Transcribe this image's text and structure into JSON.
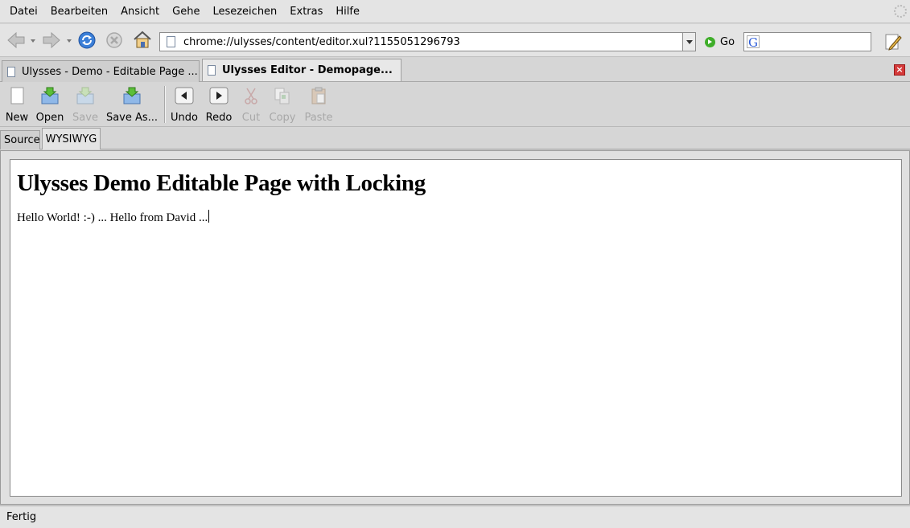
{
  "menubar": {
    "items": [
      {
        "label": "Datei"
      },
      {
        "label": "Bearbeiten"
      },
      {
        "label": "Ansicht"
      },
      {
        "label": "Gehe"
      },
      {
        "label": "Lesezeichen"
      },
      {
        "label": "Extras"
      },
      {
        "label": "Hilfe"
      }
    ]
  },
  "navbar": {
    "url": "chrome://ulysses/content/editor.xul?1155051296793",
    "go_label": "Go",
    "search_value": ""
  },
  "tabs": [
    {
      "label": "Ulysses - Demo - Editable Page ...",
      "active": false
    },
    {
      "label": "Ulysses Editor - Demopage...",
      "active": true
    }
  ],
  "editor_toolbar": {
    "new": "New",
    "open": "Open",
    "save": "Save",
    "save_as": "Save As...",
    "undo": "Undo",
    "redo": "Redo",
    "cut": "Cut",
    "copy": "Copy",
    "paste": "Paste"
  },
  "mode_tabs": {
    "source": "Source",
    "wysiwyg": "WYSIWYG"
  },
  "document": {
    "heading": "Ulysses Demo Editable Page with Locking",
    "paragraph": "Hello World! :-) ... Hello from David ..."
  },
  "status": {
    "text": "Fertig"
  },
  "colors": {
    "chrome_bg": "#d6d6d6",
    "menubar_bg": "#e4e4e4",
    "close_red": "#d43a3a",
    "go_green": "#3fae2a"
  }
}
